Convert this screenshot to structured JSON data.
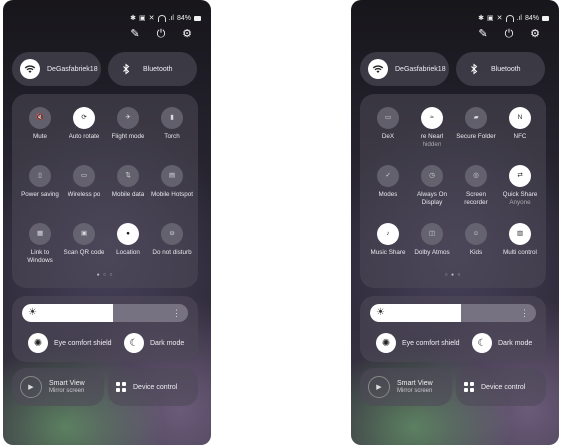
{
  "status_bar": {
    "battery": "84%"
  },
  "left": {
    "wifi_label": "DeGasfabriek18",
    "bt_label": "Bluetooth",
    "tiles": [
      {
        "name": "mute",
        "label": "Mute",
        "on": false,
        "icon": "mute-icon"
      },
      {
        "name": "auto-rotate",
        "label": "Auto rotate",
        "on": true,
        "icon": "rotate-icon"
      },
      {
        "name": "flight-mode",
        "label": "Flight mode",
        "on": false,
        "icon": "airplane-icon"
      },
      {
        "name": "torch",
        "label": "Torch",
        "on": false,
        "icon": "torch-icon"
      },
      {
        "name": "power-saving",
        "label": "Power saving",
        "on": false,
        "icon": "battery-icon"
      },
      {
        "name": "wireless-power",
        "label": "Wireless po",
        "on": false,
        "icon": "wireless-power-icon"
      },
      {
        "name": "mobile-data",
        "label": "Mobile data",
        "on": false,
        "icon": "data-arrows-icon"
      },
      {
        "name": "mobile-hotspot",
        "label": "Mobile Hotspot",
        "on": false,
        "icon": "hotspot-icon"
      },
      {
        "name": "link-to-windows",
        "label": "Link to Windows",
        "on": false,
        "icon": "windows-link-icon"
      },
      {
        "name": "scan-qr",
        "label": "Scan QR code",
        "on": false,
        "icon": "qr-icon"
      },
      {
        "name": "location",
        "label": "Location",
        "on": true,
        "icon": "location-pin-icon"
      },
      {
        "name": "do-not-disturb",
        "label": "Do not disturb",
        "on": false,
        "icon": "dnd-icon"
      }
    ]
  },
  "right": {
    "wifi_label": "DeGasfabriek18",
    "bt_label": "Bluetooth",
    "tiles": [
      {
        "name": "dex",
        "label": "DeX",
        "on": false,
        "icon": "dex-icon"
      },
      {
        "name": "nearby-share",
        "label": "re    Nearl",
        "sub": "hidden",
        "on": true,
        "icon": "nearby-icon"
      },
      {
        "name": "secure-folder",
        "label": "Secure Folder",
        "on": false,
        "icon": "folder-icon"
      },
      {
        "name": "nfc",
        "label": "NFC",
        "on": true,
        "icon": "nfc-icon"
      },
      {
        "name": "modes",
        "label": "Modes",
        "on": false,
        "icon": "modes-icon"
      },
      {
        "name": "always-on-display",
        "label": "Always On Display",
        "on": false,
        "icon": "clock-icon"
      },
      {
        "name": "screen-recorder",
        "label": "Screen recorder",
        "on": false,
        "icon": "recorder-icon"
      },
      {
        "name": "quick-share",
        "label": "Quick Share",
        "sub": "Anyone",
        "on": true,
        "icon": "quick-share-icon"
      },
      {
        "name": "music-share",
        "label": "Music Share",
        "on": true,
        "icon": "music-icon"
      },
      {
        "name": "dolby-atmos",
        "label": "Dolby Atmos",
        "on": false,
        "icon": "dolby-icon"
      },
      {
        "name": "kids",
        "label": "Kids",
        "on": false,
        "icon": "kids-icon"
      },
      {
        "name": "multi-control",
        "label": "Multi control",
        "on": true,
        "icon": "multi-control-icon"
      }
    ]
  },
  "brightness": {
    "level": 0.55
  },
  "eye_comfort_label": "Eye comfort shield",
  "dark_mode_label": "Dark mode",
  "smart_view": {
    "title": "Smart View",
    "subtitle": "Mirror screen"
  },
  "device_control_label": "Device control",
  "colors": {
    "accent": "#ffffff",
    "panel": "#4e4a58"
  }
}
